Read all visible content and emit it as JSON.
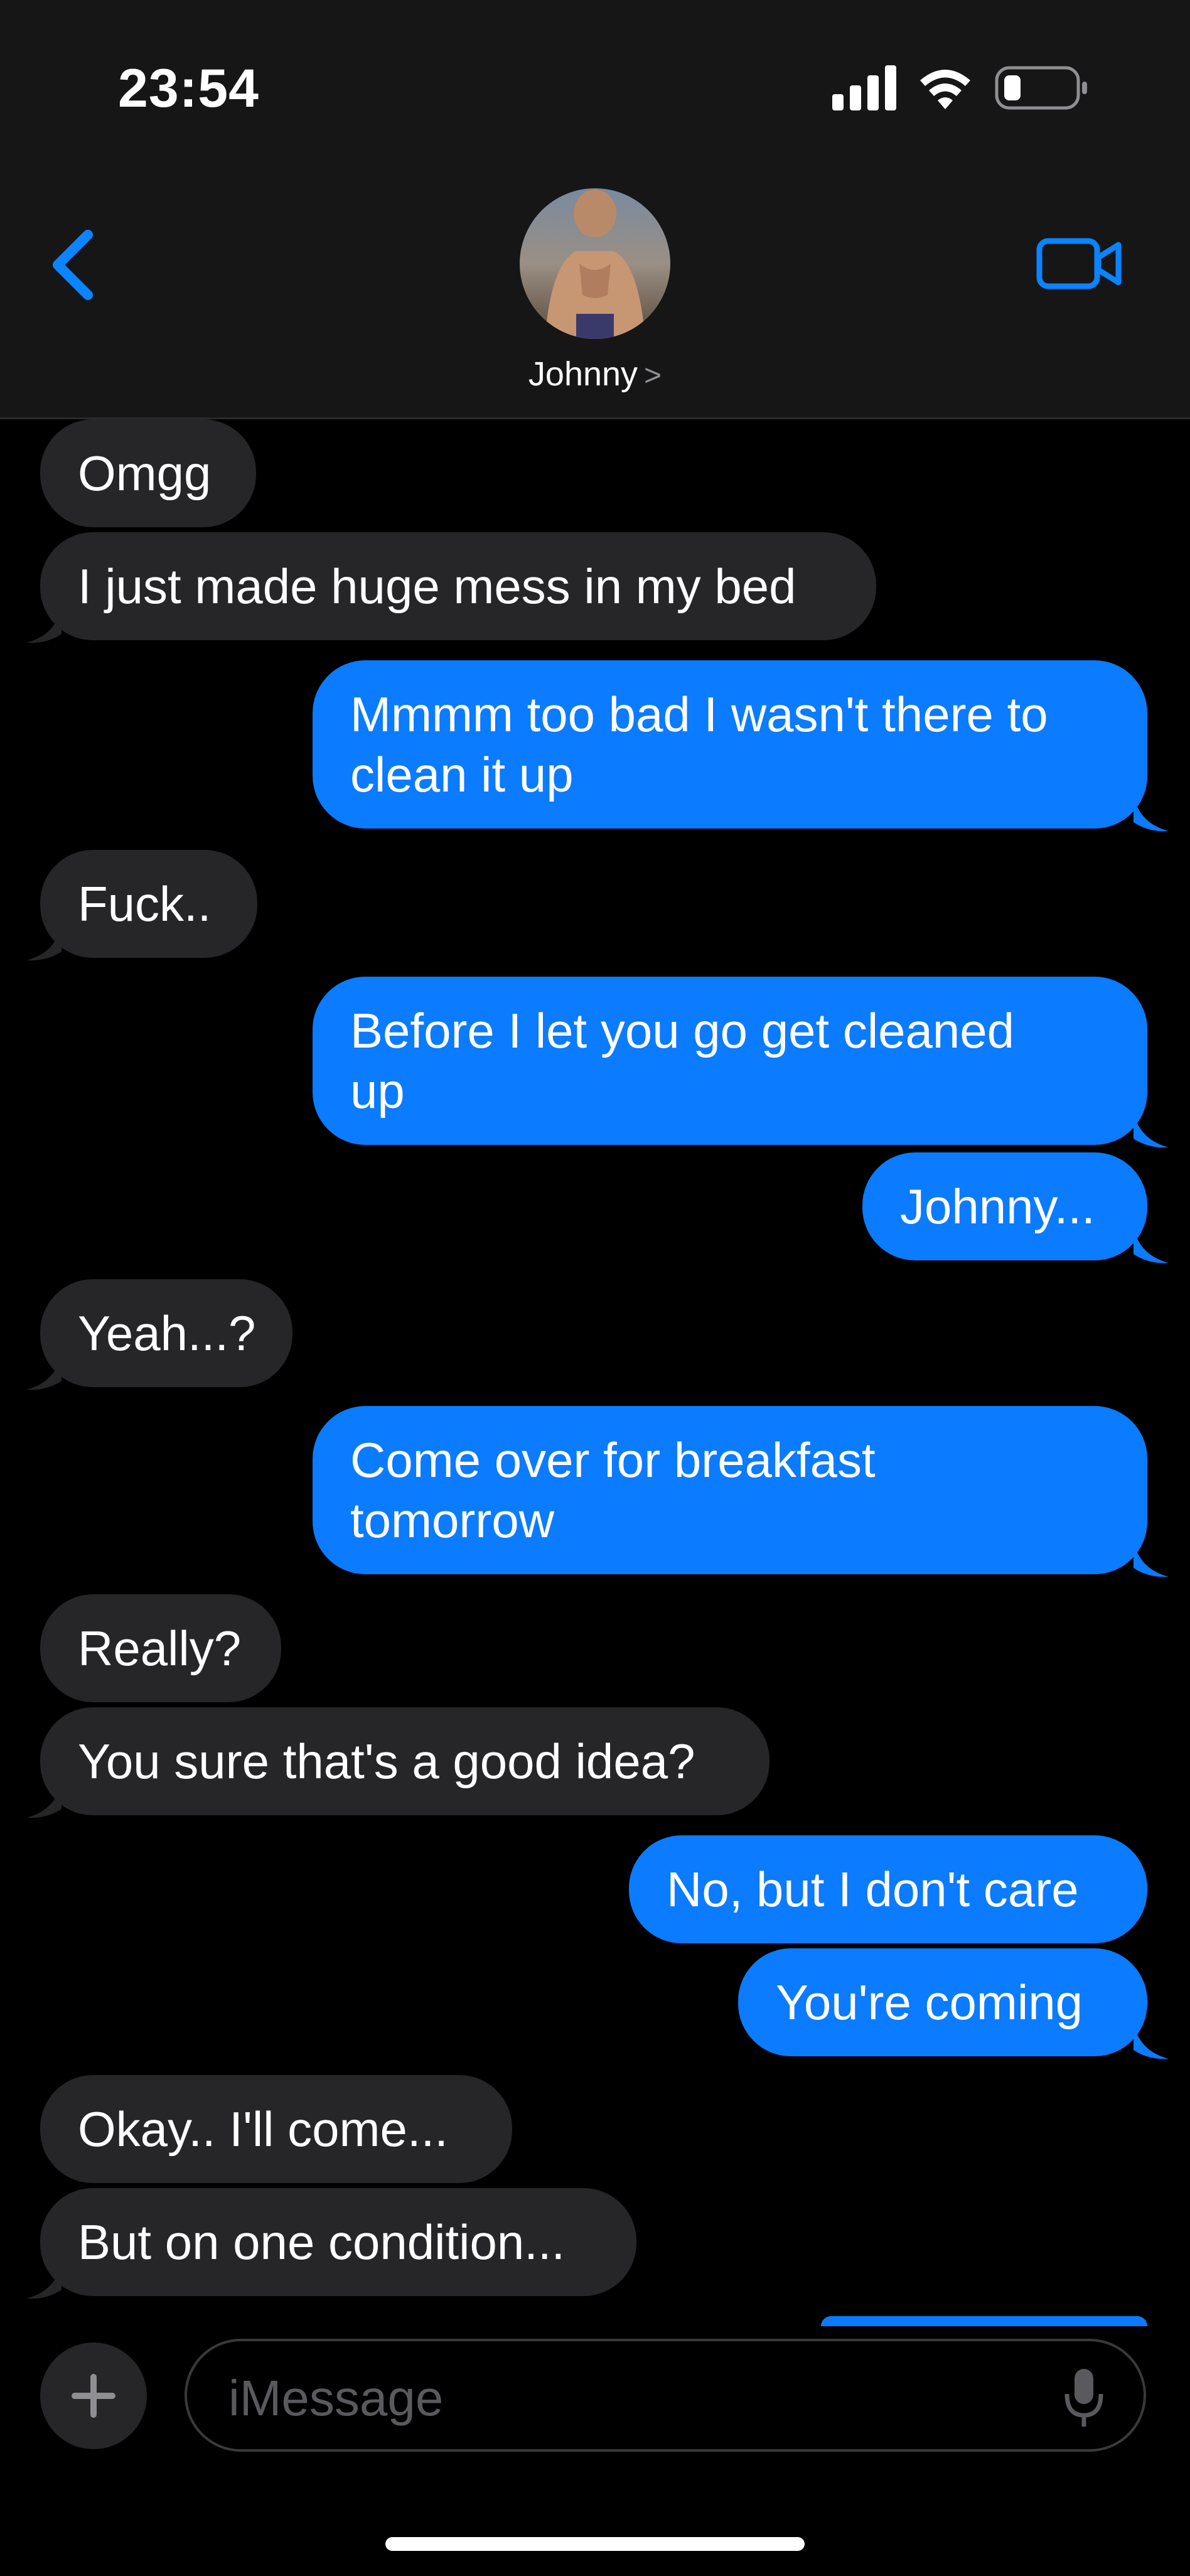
{
  "status_bar": {
    "time": "23:54"
  },
  "header": {
    "contact_name": "Johnny",
    "contact_chevron": ">"
  },
  "colors": {
    "outgoing_bubble": "#0b7bff",
    "incoming_bubble": "#262628",
    "accent": "#0a84ff"
  },
  "messages": [
    {
      "direction": "in",
      "text": "Omgg"
    },
    {
      "direction": "in",
      "text": "I just made huge mess in my bed"
    },
    {
      "direction": "out",
      "text": "Mmmm too bad I wasn't there to\nclean it up"
    },
    {
      "direction": "in",
      "text": "Fuck.."
    },
    {
      "direction": "out",
      "text": "Before I let you go get cleaned\nup"
    },
    {
      "direction": "out",
      "text": "Johnny..."
    },
    {
      "direction": "in",
      "text": "Yeah...?"
    },
    {
      "direction": "out",
      "text": "Come over for breakfast\ntomorrow"
    },
    {
      "direction": "in",
      "text": "Really?"
    },
    {
      "direction": "in",
      "text": "You sure that's a good idea?"
    },
    {
      "direction": "out",
      "text": "No, but I don't care"
    },
    {
      "direction": "out",
      "text": "You're coming"
    },
    {
      "direction": "in",
      "text": "Okay.. I'll come..."
    },
    {
      "direction": "in",
      "text": "But on one condition..."
    }
  ],
  "composer": {
    "placeholder": "iMessage",
    "value": ""
  },
  "icons": {
    "back": "chevron-left-icon",
    "video": "video-camera-icon",
    "plus": "plus-icon",
    "mic": "microphone-icon"
  }
}
